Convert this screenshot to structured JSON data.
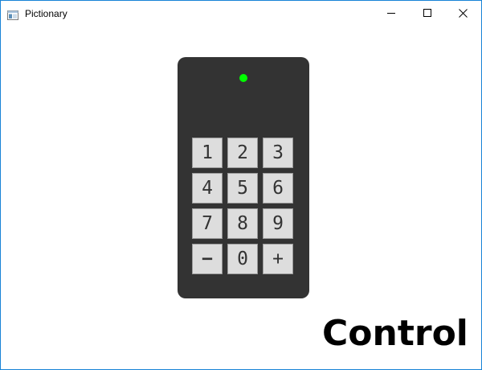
{
  "window": {
    "title": "Pictionary",
    "icon": "app-window-icon",
    "controls": [
      "minimize-icon",
      "maximize-icon",
      "close-icon"
    ]
  },
  "device": {
    "indicator": {
      "state": "on",
      "color": "#00ff00"
    },
    "body_color": "#333333",
    "keys": [
      {
        "id": "key-1",
        "label": "1"
      },
      {
        "id": "key-2",
        "label": "2"
      },
      {
        "id": "key-3",
        "label": "3"
      },
      {
        "id": "key-4",
        "label": "4"
      },
      {
        "id": "key-5",
        "label": "5"
      },
      {
        "id": "key-6",
        "label": "6"
      },
      {
        "id": "key-7",
        "label": "7"
      },
      {
        "id": "key-8",
        "label": "8"
      },
      {
        "id": "key-9",
        "label": "9"
      },
      {
        "id": "key-minus",
        "label": "−"
      },
      {
        "id": "key-0",
        "label": "0"
      },
      {
        "id": "key-plus",
        "label": "+"
      }
    ]
  },
  "footer": {
    "label": "Control"
  }
}
